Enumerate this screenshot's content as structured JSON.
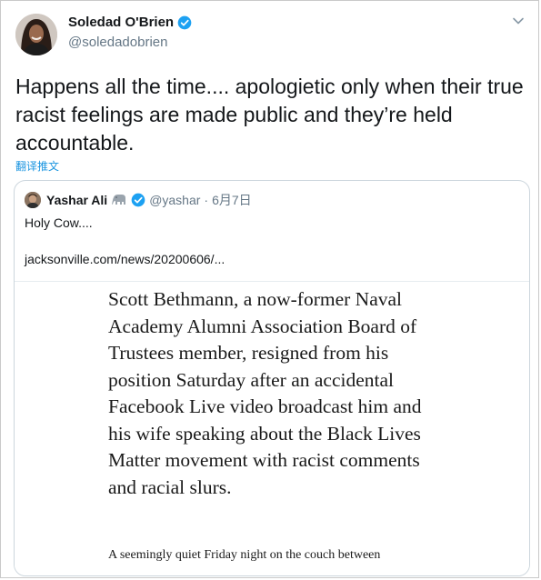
{
  "tweet": {
    "author_name": "Soledad O'Brien",
    "author_handle": "@soledadobrien",
    "text": "Happens all the time....  apologietic only when their true racist feelings are made public and they’re held accountable.",
    "translate_label": "翻译推文"
  },
  "quote": {
    "author_name": "Yashar Ali",
    "author_handle": "@yashar",
    "separator": "·",
    "date": "6月7日",
    "text": "Holy Cow....",
    "link": "jacksonville.com/news/20200606/..."
  },
  "article": {
    "lead": "Scott Bethmann, a now-former Naval Academy Alumni Association Board of Trustees member, resigned from his position Saturday after an accidental Facebook Live video broadcast him and his wife speaking about the Black Lives Matter movement with racist comments and racial slurs.",
    "next_line": "A seemingly quiet Friday night on the couch between"
  },
  "colors": {
    "link_blue": "#1b95e0",
    "verified_blue": "#1da1f2",
    "muted_gray": "#657786",
    "card_border": "#ccd6dd"
  },
  "icons": {
    "verified": "verified-badge-icon",
    "caret": "chevron-down-icon",
    "emoji": "elephant-icon"
  }
}
